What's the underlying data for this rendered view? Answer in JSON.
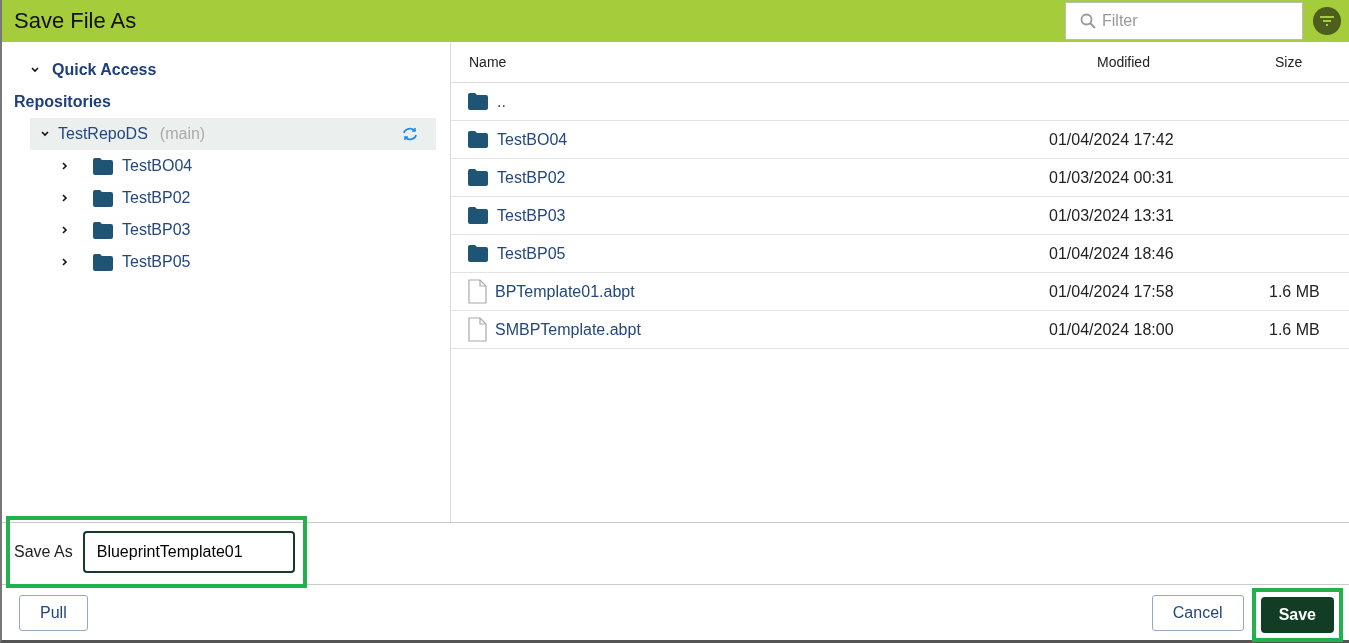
{
  "window": {
    "title": "Save File As"
  },
  "filter": {
    "placeholder": "Filter"
  },
  "sidebar": {
    "quick_access": {
      "label": "Quick Access",
      "expanded": true
    },
    "section": "Repositories",
    "repo": {
      "name": "TestRepoDS",
      "branch": "(main)",
      "expanded": true,
      "selected": true,
      "children": [
        {
          "name": "TestBO04",
          "expanded": false
        },
        {
          "name": "TestBP02",
          "expanded": false
        },
        {
          "name": "TestBP03",
          "expanded": false
        },
        {
          "name": "TestBP05",
          "expanded": false
        }
      ]
    }
  },
  "table": {
    "columns": [
      "Name",
      "Modified",
      "Size"
    ],
    "rows": [
      {
        "kind": "folder",
        "name": "..",
        "modified": "",
        "size": ""
      },
      {
        "kind": "folder",
        "name": "TestBO04",
        "modified": "01/04/2024 17:42",
        "size": ""
      },
      {
        "kind": "folder",
        "name": "TestBP02",
        "modified": "01/03/2024 00:31",
        "size": ""
      },
      {
        "kind": "folder",
        "name": "TestBP03",
        "modified": "01/03/2024 13:31",
        "size": ""
      },
      {
        "kind": "folder",
        "name": "TestBP05",
        "modified": "01/04/2024 18:46",
        "size": ""
      },
      {
        "kind": "file",
        "name": "BPTemplate01.abpt",
        "modified": "01/04/2024 17:58",
        "size": "1.6 MB"
      },
      {
        "kind": "file",
        "name": "SMBPTemplate.abpt",
        "modified": "01/04/2024 18:00",
        "size": "1.6 MB"
      }
    ]
  },
  "save_as": {
    "label": "Save As",
    "value": "BlueprintTemplate01",
    "highlighted": true
  },
  "buttons": {
    "pull": "Pull",
    "cancel": "Cancel",
    "save": "Save",
    "save_highlighted": true
  }
}
